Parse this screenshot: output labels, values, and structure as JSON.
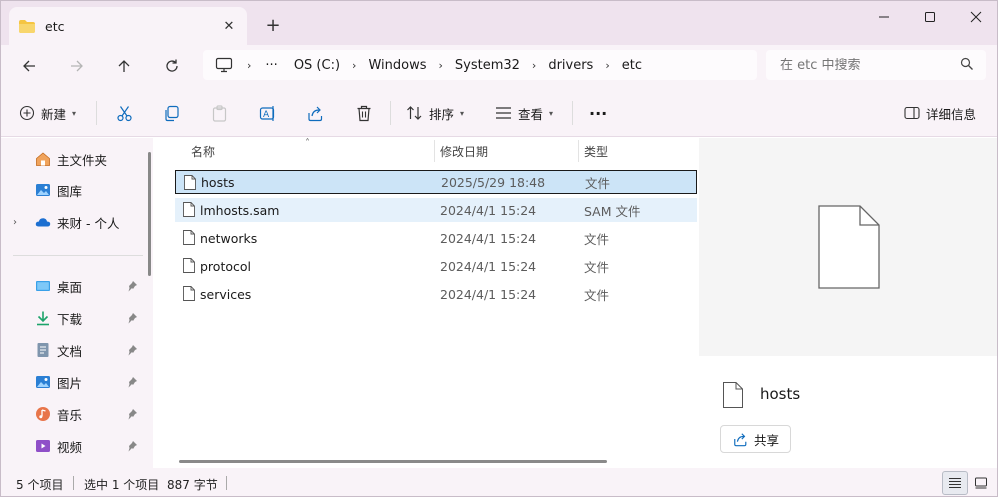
{
  "window": {
    "tab_title": "etc",
    "new_tab_label": "+",
    "close_tab_label": "✕"
  },
  "address": {
    "more_label": "···",
    "segments": [
      "OS (C:)",
      "Windows",
      "System32",
      "drivers",
      "etc"
    ]
  },
  "search": {
    "placeholder": "在 etc 中搜索"
  },
  "toolbar": {
    "new_label": "新建",
    "sort_label": "排序",
    "view_label": "查看",
    "more_label": "···",
    "details_label": "详细信息"
  },
  "sidebar": {
    "items": [
      {
        "label": "主文件夹",
        "icon": "home-icon"
      },
      {
        "label": "图库",
        "icon": "gallery-icon"
      },
      {
        "label": "来财 - 个人",
        "icon": "onedrive-cloud-icon"
      },
      {
        "label": "桌面",
        "icon": "desktop-icon"
      },
      {
        "label": "下载",
        "icon": "download-icon"
      },
      {
        "label": "文档",
        "icon": "document-icon"
      },
      {
        "label": "图片",
        "icon": "pictures-icon"
      },
      {
        "label": "音乐",
        "icon": "music-icon"
      },
      {
        "label": "视频",
        "icon": "video-icon"
      }
    ]
  },
  "filelist": {
    "columns": {
      "name": "名称",
      "date": "修改日期",
      "type": "类型"
    },
    "rows": [
      {
        "name": "hosts",
        "date": "2025/5/29 18:48",
        "type": "文件",
        "state": "selected"
      },
      {
        "name": "lmhosts.sam",
        "date": "2024/4/1 15:24",
        "type": "SAM 文件",
        "state": "hover"
      },
      {
        "name": "networks",
        "date": "2024/4/1 15:24",
        "type": "文件",
        "state": "normal"
      },
      {
        "name": "protocol",
        "date": "2024/4/1 15:24",
        "type": "文件",
        "state": "normal"
      },
      {
        "name": "services",
        "date": "2024/4/1 15:24",
        "type": "文件",
        "state": "normal"
      }
    ]
  },
  "preview": {
    "file_name": "hosts",
    "share_label": "共享"
  },
  "status": {
    "item_count": "5 个项目",
    "selection": "选中 1 个项目",
    "size": "887 字节"
  },
  "colors": {
    "chrome": "#f9f3f8",
    "titlebar": "#efe3ee",
    "selection": "#cce4f7",
    "hover": "#e5f1fb",
    "accent_blue": "#0f6cbd",
    "folder_yellow": "#f5c542"
  }
}
